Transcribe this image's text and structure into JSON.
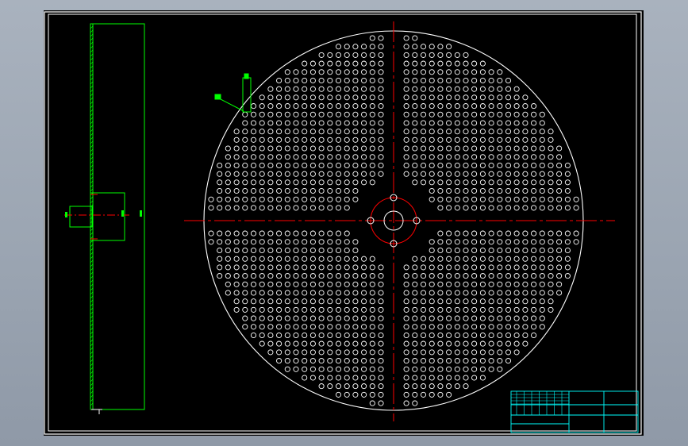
{
  "colors": {
    "background": "#000000",
    "outline": "#ffffff",
    "sheet_border": "#ffffff",
    "side_view": "#00ff00",
    "centerline": "#ff0000",
    "dimension": "#00ff00",
    "title_block": "#00ffff",
    "hub": "#ff0000"
  },
  "drawing": {
    "title": "",
    "side_view": {
      "label": "side-section-view"
    },
    "front_view": {
      "label": "perforated-disc",
      "hole_pattern": "square-grid"
    },
    "title_block": {
      "cells": [
        "",
        "",
        "",
        ""
      ]
    }
  }
}
